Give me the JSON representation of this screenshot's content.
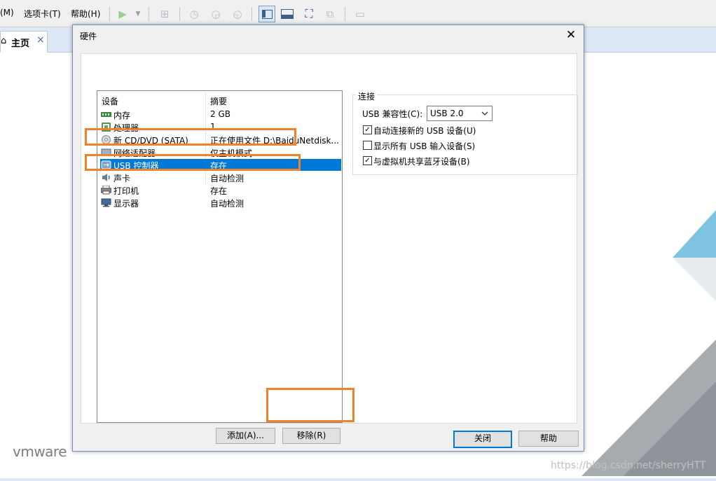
{
  "menubar": {
    "items": [
      "(M)",
      "选项卡(T)",
      "帮助(H)"
    ]
  },
  "tabs": {
    "home_label": "主页",
    "close_glyph": "×"
  },
  "brand": {
    "logo_text": "vmware",
    "watermark_url": "https://blog.csdn.net/sherryHTT"
  },
  "dialog": {
    "title": "硬件",
    "close_glyph": "✕",
    "list": {
      "header_device": "设备",
      "header_summary": "摘要",
      "rows": [
        {
          "name": "内存",
          "summary": "2 GB",
          "icon": "memory-icon"
        },
        {
          "name": "处理器",
          "summary": "1",
          "icon": "processor-icon"
        },
        {
          "name": "新 CD/DVD (SATA)",
          "summary": "正在使用文件 D:\\BaiduNetdisk...",
          "icon": "cd-dvd-icon"
        },
        {
          "name": "网络适配器",
          "summary": "仅主机模式",
          "icon": "network-adapter-icon"
        },
        {
          "name": "USB 控制器",
          "summary": "存在",
          "icon": "usb-icon"
        },
        {
          "name": "声卡",
          "summary": "自动检测",
          "icon": "sound-card-icon"
        },
        {
          "name": "打印机",
          "summary": "存在",
          "icon": "printer-icon"
        },
        {
          "name": "显示器",
          "summary": "自动检测",
          "icon": "display-icon"
        }
      ],
      "selected_index": 4
    },
    "add_button": "添加(A)...",
    "remove_button": "移除(R)",
    "ok_button": "关闭",
    "help_button": "帮助",
    "connection": {
      "legend": "连接",
      "compat_label": "USB 兼容性(C):",
      "compat_value": "USB 2.0",
      "auto_connect": {
        "label": "自动连接新的 USB 设备(U)",
        "checked": true
      },
      "show_all": {
        "label": "显示所有 USB 输入设备(S)",
        "checked": false
      },
      "share_bt": {
        "label": "与虚拟机共享蓝牙设备(B)",
        "checked": true
      }
    }
  },
  "colors": {
    "highlight_orange": "#f0822a",
    "selection_blue": "#0078d7"
  }
}
